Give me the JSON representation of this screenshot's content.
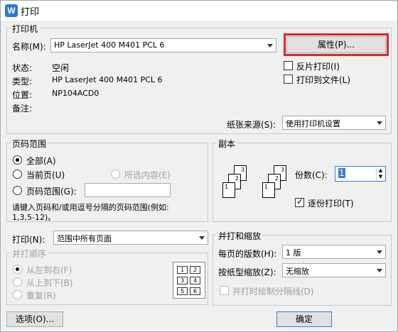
{
  "window": {
    "title": "打印"
  },
  "printer": {
    "group_title": "打印机",
    "name_label": "名称(M):",
    "name_value": "HP LaserJet 400 M401 PCL 6",
    "properties_button": "属性(P)...",
    "status_label": "状态:",
    "status_value": "空闲",
    "type_label": "类型:",
    "type_value": "HP LaserJet 400 M401 PCL 6",
    "location_label": "位置:",
    "location_value": "NP104ACD0",
    "comment_label": "备注:",
    "reverse_print_label": "反片打印(I)",
    "print_to_file_label": "打印到文件(L)",
    "paper_source_label": "纸张来源(S):",
    "paper_source_value": "使用打印机设置"
  },
  "page_range": {
    "group_title": "页码范围",
    "all_label": "全部(A)",
    "current_page_label": "当前页(U)",
    "selection_label": "所选内容(E)",
    "pages_label": "页码范围(G):",
    "pages_value": "",
    "hint": "请键入页码和/或用逗号分隔的页码范围(例如:",
    "hint_example": "1,3,5-12)。"
  },
  "print_what": {
    "label": "打印(N):",
    "value": "范围中所有页面"
  },
  "collate_order": {
    "group_title": "并打顺序",
    "left_to_right": "从左到右(F)",
    "top_to_bottom": "从上到下(B)",
    "repeat": "重复(R)",
    "preview_numbers": [
      "1",
      "2",
      "3",
      "4",
      "5",
      "6"
    ]
  },
  "copies": {
    "group_title": "副本",
    "count_label": "份数(C):",
    "count_value": "1",
    "collate_label": "逐份打印(T)",
    "page_numbers": [
      "1",
      "2",
      "3"
    ]
  },
  "zoom": {
    "group_title": "并打和缩放",
    "pages_per_sheet_label": "每页的版数(H):",
    "pages_per_sheet_value": "1 版",
    "scale_label": "按纸型缩放(Z):",
    "scale_value": "无缩放",
    "draw_lines_label": "并打时绘制分隔线(D)"
  },
  "footer": {
    "options_button": "选项(O)...",
    "ok_button": "确定"
  },
  "colors": {
    "highlight": "#d9272e",
    "titlebar_icon": "#2b78d8"
  }
}
